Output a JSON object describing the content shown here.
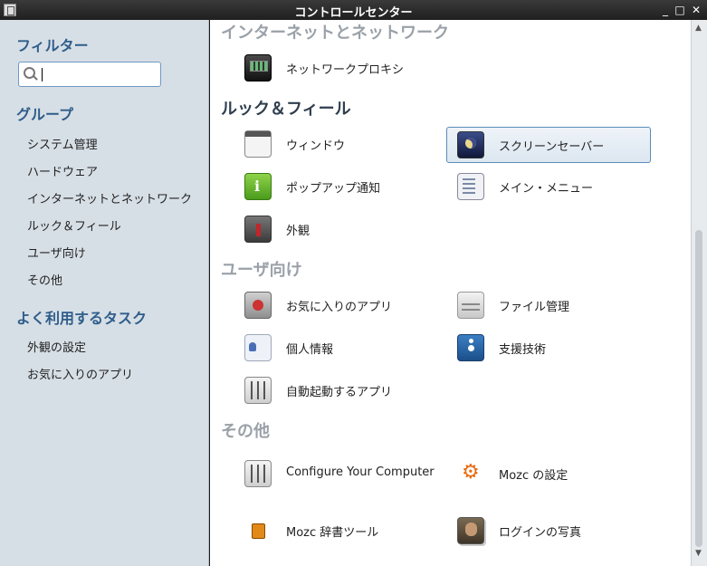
{
  "window": {
    "title": "コントロールセンター",
    "controls": [
      "_",
      "□",
      "✕"
    ]
  },
  "sidebar": {
    "filter_heading": "フィルター",
    "search": {
      "value": "",
      "placeholder": ""
    },
    "groups_heading": "グループ",
    "groups": [
      "システム管理",
      "ハードウェア",
      "インターネットとネットワーク",
      "ルック＆フィール",
      "ユーザ向け",
      "その他"
    ],
    "tasks_heading": "よく利用するタスク",
    "tasks": [
      "外観の設定",
      "お気に入りのアプリ"
    ]
  },
  "main": {
    "categories": [
      {
        "title": "インターネットとネットワーク",
        "items": [
          {
            "label": "ネットワークプロキシ",
            "icon": "network-proxy-icon"
          }
        ]
      },
      {
        "title": "ルック＆フィール",
        "items": [
          {
            "label": "ウィンドウ",
            "icon": "window-icon"
          },
          {
            "label": "スクリーンセーバー",
            "icon": "screensaver-icon",
            "selected": true
          },
          {
            "label": "ポップアップ通知",
            "icon": "popup-notification-icon"
          },
          {
            "label": "メイン・メニュー",
            "icon": "main-menu-icon"
          },
          {
            "label": "外観",
            "icon": "appearance-icon"
          }
        ]
      },
      {
        "title": "ユーザ向け",
        "items": [
          {
            "label": "お気に入りのアプリ",
            "icon": "favorite-apps-icon"
          },
          {
            "label": "ファイル管理",
            "icon": "file-management-icon"
          },
          {
            "label": "個人情報",
            "icon": "personal-info-icon"
          },
          {
            "label": "支援技術",
            "icon": "accessibility-icon"
          },
          {
            "label": "自動起動するアプリ",
            "icon": "startup-apps-icon"
          }
        ]
      },
      {
        "title": "その他",
        "items": [
          {
            "label": "Configure Your Computer",
            "icon": "configure-computer-icon"
          },
          {
            "label": "Mozc の設定",
            "icon": "mozc-settings-icon"
          },
          {
            "label": "Mozc 辞書ツール",
            "icon": "mozc-dictionary-icon"
          },
          {
            "label": "ログインの写真",
            "icon": "login-photo-icon"
          }
        ]
      }
    ]
  },
  "colors": {
    "heading": "#2f5d8a",
    "active_category": "#2f3e4e",
    "dim_category": "#9aa1a8",
    "selection_border": "#5b8db8"
  }
}
